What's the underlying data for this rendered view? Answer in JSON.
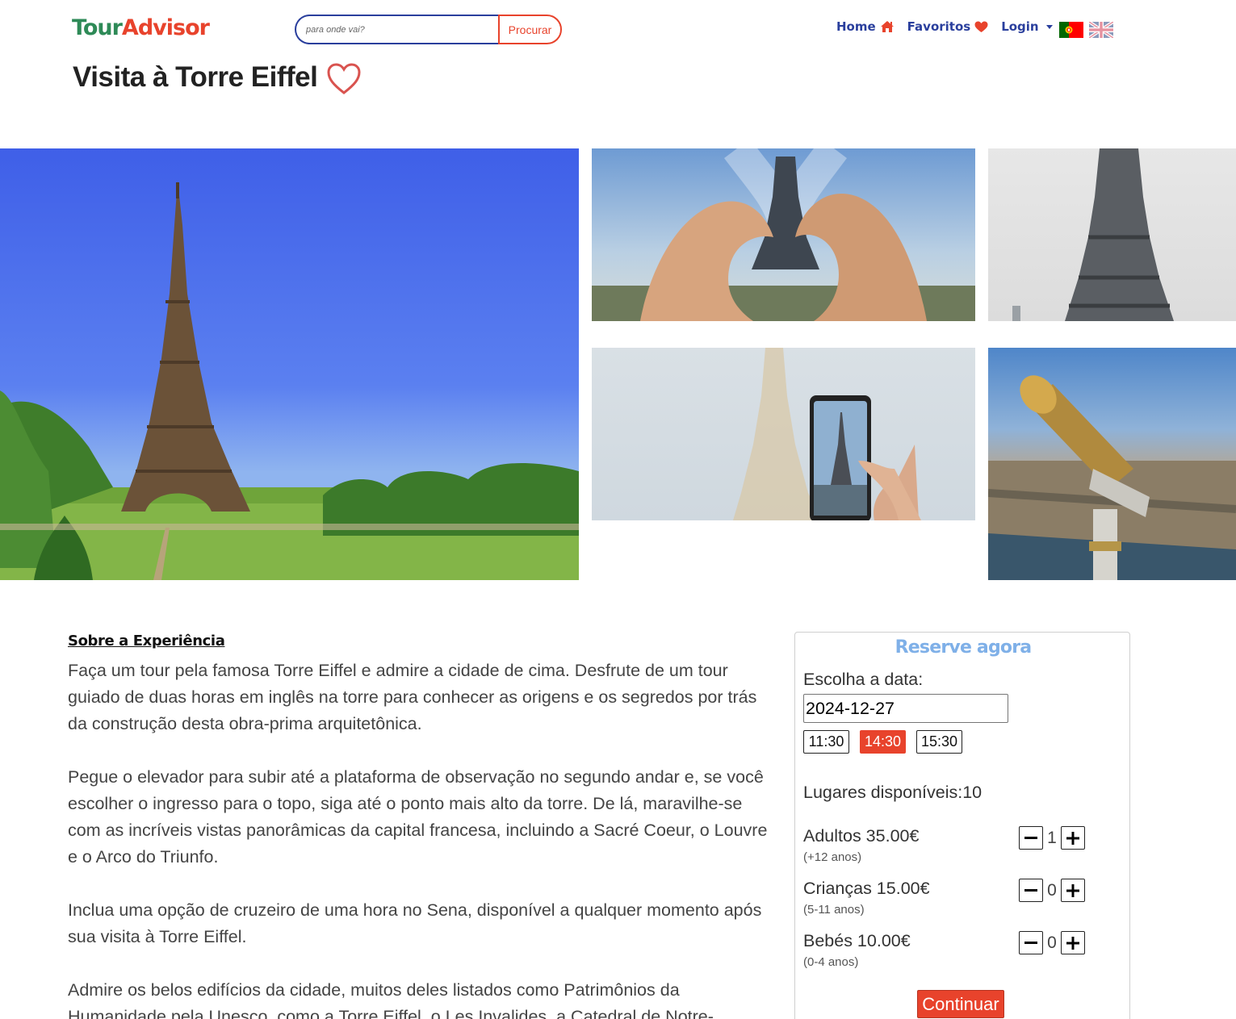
{
  "brand": {
    "part1": "Tour",
    "part2": "Advisor",
    "color1": "#2e8a57",
    "color2": "#e8432c"
  },
  "search": {
    "placeholder": "para onde vai?",
    "button": "Procurar"
  },
  "nav": {
    "items": [
      {
        "label": "Home",
        "icon": "home-icon"
      },
      {
        "label": "Favoritos",
        "icon": "heart-icon"
      },
      {
        "label": "Login",
        "icon": "caret-down-icon"
      }
    ],
    "languages": [
      {
        "icon": "flag-portugal-icon",
        "active": true
      },
      {
        "icon": "flag-uk-icon",
        "active": false
      }
    ]
  },
  "page": {
    "title": "Visita à Torre Eiffel",
    "favorite_icon": "heart-outline-icon"
  },
  "gallery": [
    {
      "subject": "Eiffel Tower over Champ de Mars"
    },
    {
      "subject": "Hands forming heart around Eiffel Tower"
    },
    {
      "subject": "Eiffel Tower close-up"
    },
    {
      "subject": "Phone photographing Eiffel Tower"
    },
    {
      "subject": "Coin telescope overlooking Paris"
    }
  ],
  "about": {
    "heading": "Sobre a Experiência",
    "paragraphs": [
      "Faça um tour pela famosa Torre Eiffel e admire a cidade de cima. Desfrute de um tour guiado de duas horas em inglês na torre para conhecer as origens e os segredos por trás da construção desta obra-prima arquitetônica.",
      "Pegue o elevador para subir até a plataforma de observação no segundo andar e, se você escolher o ingresso para o topo, siga até o ponto mais alto da torre. De lá, maravilhe-se com as incríveis vistas panorâmicas da capital francesa, incluindo a Sacré Coeur, o Louvre e o Arco do Triunfo.",
      "Inclua uma opção de cruzeiro de uma hora no Sena, disponível a qualquer momento após sua visita à Torre Eiffel.",
      "Admire os belos edifícios da cidade, muitos deles listados como Patrimônios da Humanidade pela Unesco, como a Torre Eiffel, o Les Invalides, a Catedral de Notre-"
    ]
  },
  "booking": {
    "title": "Reserve agora",
    "date_label": "Escolha a data:",
    "date_value": "2024-12-27",
    "times": [
      {
        "label": "11:30",
        "selected": false
      },
      {
        "label": "14:30",
        "selected": true
      },
      {
        "label": "15:30",
        "selected": false
      }
    ],
    "seats": "Lugares disponíveis:10",
    "tickets": [
      {
        "name": "Adultos 35.00€",
        "ages": "(+12 anos)",
        "qty": "1"
      },
      {
        "name": "Crianças 15.00€",
        "ages": "(5-11 anos)",
        "qty": "0"
      },
      {
        "name": "Bebés 10.00€",
        "ages": "(0-4 anos)",
        "qty": "0"
      }
    ],
    "continue": "Continuar",
    "accent": "#e8432c",
    "title_color": "#7fb0e8"
  }
}
